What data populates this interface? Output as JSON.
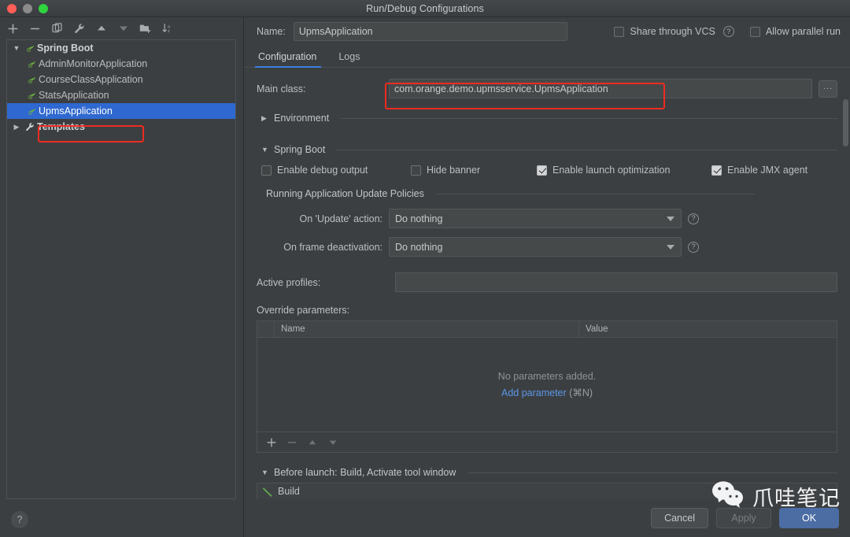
{
  "window": {
    "title": "Run/Debug Configurations",
    "traffic_lights": [
      "close",
      "minimize",
      "zoom"
    ]
  },
  "left_panel": {
    "toolbar": [
      {
        "name": "add-configuration-button",
        "icon": "plus-icon"
      },
      {
        "name": "remove-configuration-button",
        "icon": "minus-icon"
      },
      {
        "name": "copy-configuration-button",
        "icon": "copy-icon"
      },
      {
        "name": "edit-templates-button",
        "icon": "wrench-icon"
      },
      {
        "name": "move-up-button",
        "icon": "arrow-up-icon"
      },
      {
        "name": "move-down-button",
        "icon": "arrow-down-icon"
      },
      {
        "name": "new-folder-button",
        "icon": "folder-add-icon"
      },
      {
        "name": "sort-configurations-button",
        "icon": "sort-az-icon"
      }
    ],
    "tree": [
      {
        "label": "Spring Boot",
        "level": 0,
        "expanded": true,
        "icon": "spring-boot-icon",
        "bold": true,
        "selected": false
      },
      {
        "label": "AdminMonitorApplication",
        "level": 1,
        "icon": "spring-boot-icon",
        "bold": false,
        "selected": false
      },
      {
        "label": "CourseClassApplication",
        "level": 1,
        "icon": "spring-boot-icon",
        "bold": false,
        "selected": false
      },
      {
        "label": "StatsApplication",
        "level": 1,
        "icon": "spring-boot-icon",
        "bold": false,
        "selected": false
      },
      {
        "label": "UpmsApplication",
        "level": 1,
        "icon": "spring-boot-icon",
        "bold": false,
        "selected": true
      },
      {
        "label": "Templates",
        "level": 0,
        "expanded": false,
        "icon": "wrench-icon",
        "bold": true,
        "selected": false
      }
    ],
    "help_button": "?"
  },
  "header": {
    "name_label": "Name:",
    "name_value": "UpmsApplication",
    "name_placeholder": "",
    "share_through_vcs": {
      "label": "Share through VCS",
      "checked": false
    },
    "share_help": "?",
    "allow_parallel_run": {
      "label": "Allow parallel run",
      "checked": false
    }
  },
  "tabs": [
    {
      "label": "Configuration",
      "active": true
    },
    {
      "label": "Logs",
      "active": false
    }
  ],
  "configuration": {
    "main_class": {
      "label": "Main class:",
      "value": "com.orange.demo.upmsservice.UpmsApplication",
      "placeholder": "",
      "browse_label": "...",
      "highlighted": true
    },
    "environment_section": {
      "label": "Environment",
      "expanded": false
    },
    "spring_boot_section": {
      "label": "Spring Boot",
      "expanded": true
    },
    "spring_boot_checkboxes": [
      {
        "label": "Enable debug output",
        "checked": false
      },
      {
        "label": "Hide banner",
        "checked": false
      },
      {
        "label": "Enable launch optimization",
        "checked": true
      },
      {
        "label": "Enable JMX agent",
        "checked": true
      }
    ],
    "update_policies_section": {
      "label": "Running Application Update Policies"
    },
    "update_policies": [
      {
        "label": "On 'Update' action:",
        "value": "Do nothing",
        "help": "?"
      },
      {
        "label": "On frame deactivation:",
        "value": "Do nothing",
        "help": "?"
      }
    ],
    "active_profiles": {
      "label": "Active profiles:",
      "value": "",
      "placeholder": ""
    },
    "override_parameters": {
      "label": "Override parameters:",
      "columns": [
        "Name",
        "Value"
      ],
      "rows": [],
      "empty_text": "No parameters added.",
      "add_link": "Add parameter",
      "add_shortcut": "(⌘N)",
      "footer_buttons": [
        {
          "name": "add-parameter-button",
          "icon": "plus-icon",
          "enabled": true
        },
        {
          "name": "remove-parameter-button",
          "icon": "minus-icon",
          "enabled": false
        },
        {
          "name": "move-parameter-up-button",
          "icon": "arrow-up-icon",
          "enabled": false
        },
        {
          "name": "move-parameter-down-button",
          "icon": "arrow-down-icon",
          "enabled": false
        }
      ]
    },
    "before_launch": {
      "label": "Before launch: Build, Activate tool window",
      "expanded": true,
      "items": [
        {
          "label": "Build",
          "icon": "build-hammer-icon"
        }
      ]
    }
  },
  "footer": {
    "cancel": "Cancel",
    "apply": "Apply",
    "apply_enabled": false,
    "ok": "OK"
  },
  "watermark": {
    "text": "爪哇笔记",
    "icon": "wechat-icon"
  },
  "colors": {
    "window_bg": "#3c3f41",
    "selection_blue": "#2f68d0",
    "accent_tab": "#3c7fe0",
    "link_blue": "#5c97e8",
    "highlight_red": "#ee2b20",
    "ok_button": "#4b6da4",
    "spring_green": "#6db33f"
  }
}
